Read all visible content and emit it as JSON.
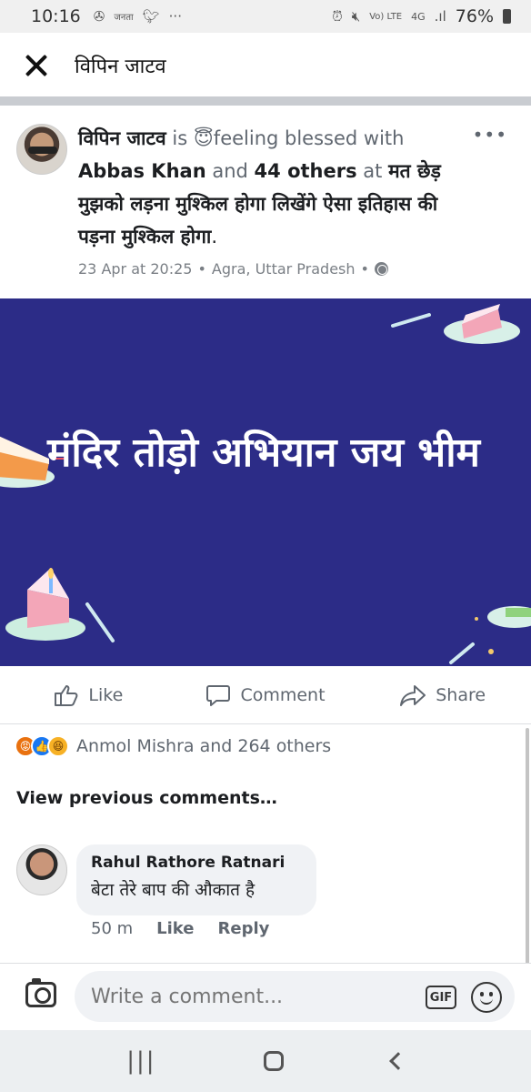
{
  "status_bar": {
    "time": "10:16",
    "notif_label": "जनता",
    "network": "Vo) LTE",
    "net_type": "4G",
    "battery": "76%"
  },
  "header": {
    "title": "विपिन जाटव"
  },
  "post": {
    "author": "विपिन जाटव",
    "is_word": "is",
    "feeling_emoji": "😇",
    "feeling": "feeling blessed with",
    "tagged": "Abbas Khan",
    "and_word": "and",
    "others": "44 others",
    "at_word": "at",
    "place_text": "मत छेड़ मुझको लड़ना मुश्किल होगा लिखेंगे ऐसा इतिहास की पड़ना मुश्किल होगा",
    "date": "23 Apr at 20:25",
    "location": "Agra, Uttar Pradesh",
    "image_text": "मंदिर तोड़ो अभियान  जय भीम"
  },
  "actions": {
    "like": "Like",
    "comment": "Comment",
    "share": "Share"
  },
  "reactions": {
    "text": "Anmol Mishra and 264 others"
  },
  "view_previous": "View previous comments…",
  "comment": {
    "name": "Rahul Rathore Ratnari",
    "body": "बेटा तेरे बाप की औकात है",
    "time": "50 m",
    "like": "Like",
    "reply": "Reply"
  },
  "composer": {
    "placeholder": "Write a comment...",
    "gif": "GIF"
  },
  "colors": {
    "image_bg": "#2c2c87",
    "muted_text": "#606770"
  }
}
